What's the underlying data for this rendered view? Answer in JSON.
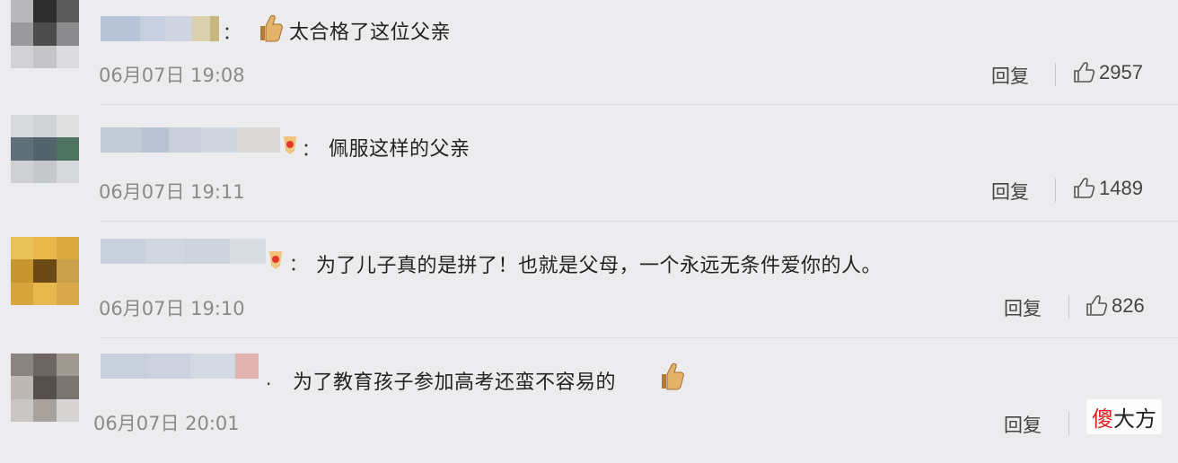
{
  "comments": [
    {
      "text": "太合格了这位父亲",
      "time": "06月07日 19:08",
      "reply_label": "回复",
      "likes": "2957",
      "separator": "：",
      "leading_emoji": "thumbs-up-icon"
    },
    {
      "text": "佩服这样的父亲",
      "time": "06月07日 19:11",
      "reply_label": "回复",
      "likes": "1489",
      "separator": "："
    },
    {
      "text": "为了儿子真的是拼了！也就是父母，一个永远无条件爱你的人。",
      "time": "06月07日 19:10",
      "reply_label": "回复",
      "likes": "826",
      "separator": "："
    },
    {
      "text": "为了教育孩子参加高考还蛮不容易的",
      "time": "06月07日 20:01",
      "reply_label": "回复",
      "separator": ".",
      "trailing_emoji": "thumbs-up-icon"
    }
  ],
  "watermark": {
    "part1": "傻",
    "part2": "大方"
  },
  "colors": {
    "background": "#ececee",
    "time": "#8a8a8a",
    "watermark_accent": "#e02020"
  }
}
